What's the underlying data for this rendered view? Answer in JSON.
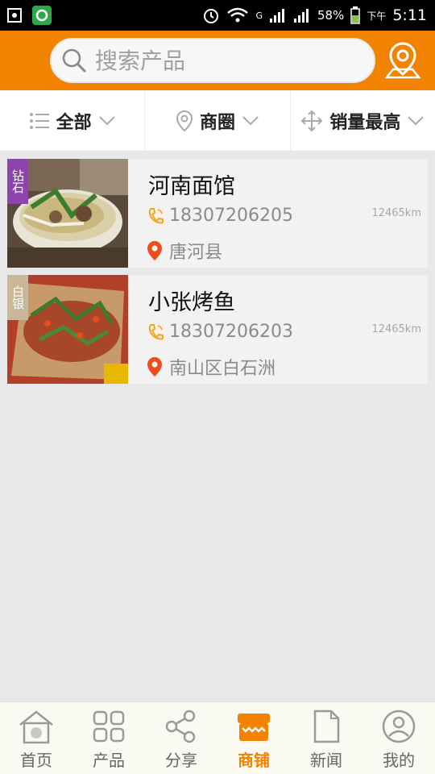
{
  "status_bar": {
    "battery": "58%",
    "ampm": "下午",
    "time": "5:11",
    "network": "G",
    "icons": [
      "screenshot-icon",
      "app-notification-icon",
      "alarm-icon",
      "wifi-icon",
      "signal-icon",
      "battery-icon"
    ]
  },
  "search": {
    "placeholder": "搜索产品"
  },
  "filters": [
    {
      "label": "全部",
      "icon": "list-icon"
    },
    {
      "label": "商圈",
      "icon": "location-pin-icon"
    },
    {
      "label": "销量最高",
      "icon": "move-arrows-icon"
    }
  ],
  "shops": [
    {
      "name": "河南面馆",
      "phone": "18307206205",
      "distance": "12465km",
      "address": "唐河县",
      "badge": "钻石",
      "badge_color": "#8e44ad",
      "image": "noodle-soup-photo"
    },
    {
      "name": "小张烤鱼",
      "phone": "18307206203",
      "distance": "12465km",
      "address": "南山区白石洲",
      "badge": "白银",
      "badge_color": "#c9b79a",
      "image": "grilled-fish-photo"
    }
  ],
  "nav": [
    {
      "label": "首页",
      "icon": "home-icon",
      "active": false
    },
    {
      "label": "产品",
      "icon": "grid-icon",
      "active": false
    },
    {
      "label": "分享",
      "icon": "share-icon",
      "active": false
    },
    {
      "label": "商铺",
      "icon": "shop-icon",
      "active": true
    },
    {
      "label": "新闻",
      "icon": "document-icon",
      "active": false
    },
    {
      "label": "我的",
      "icon": "user-icon",
      "active": false
    }
  ],
  "colors": {
    "accent": "#f18300",
    "phone_icon": "#f5a623",
    "pin_icon": "#ee4b1a"
  }
}
